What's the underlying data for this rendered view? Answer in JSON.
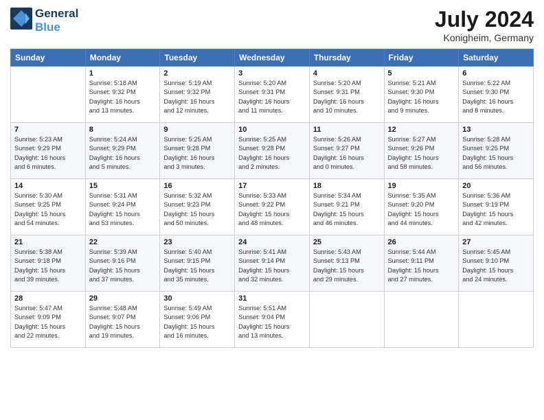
{
  "header": {
    "logo_line1": "General",
    "logo_line2": "Blue",
    "month": "July 2024",
    "location": "Konigheim, Germany"
  },
  "days_of_week": [
    "Sunday",
    "Monday",
    "Tuesday",
    "Wednesday",
    "Thursday",
    "Friday",
    "Saturday"
  ],
  "weeks": [
    [
      {
        "day": "",
        "info": ""
      },
      {
        "day": "1",
        "info": "Sunrise: 5:18 AM\nSunset: 9:32 PM\nDaylight: 16 hours\nand 13 minutes."
      },
      {
        "day": "2",
        "info": "Sunrise: 5:19 AM\nSunset: 9:32 PM\nDaylight: 16 hours\nand 12 minutes."
      },
      {
        "day": "3",
        "info": "Sunrise: 5:20 AM\nSunset: 9:31 PM\nDaylight: 16 hours\nand 11 minutes."
      },
      {
        "day": "4",
        "info": "Sunrise: 5:20 AM\nSunset: 9:31 PM\nDaylight: 16 hours\nand 10 minutes."
      },
      {
        "day": "5",
        "info": "Sunrise: 5:21 AM\nSunset: 9:30 PM\nDaylight: 16 hours\nand 9 minutes."
      },
      {
        "day": "6",
        "info": "Sunrise: 5:22 AM\nSunset: 9:30 PM\nDaylight: 16 hours\nand 8 minutes."
      }
    ],
    [
      {
        "day": "7",
        "info": "Sunrise: 5:23 AM\nSunset: 9:29 PM\nDaylight: 16 hours\nand 6 minutes."
      },
      {
        "day": "8",
        "info": "Sunrise: 5:24 AM\nSunset: 9:29 PM\nDaylight: 16 hours\nand 5 minutes."
      },
      {
        "day": "9",
        "info": "Sunrise: 5:25 AM\nSunset: 9:28 PM\nDaylight: 16 hours\nand 3 minutes."
      },
      {
        "day": "10",
        "info": "Sunrise: 5:25 AM\nSunset: 9:28 PM\nDaylight: 16 hours\nand 2 minutes."
      },
      {
        "day": "11",
        "info": "Sunrise: 5:26 AM\nSunset: 9:27 PM\nDaylight: 16 hours\nand 0 minutes."
      },
      {
        "day": "12",
        "info": "Sunrise: 5:27 AM\nSunset: 9:26 PM\nDaylight: 15 hours\nand 58 minutes."
      },
      {
        "day": "13",
        "info": "Sunrise: 5:28 AM\nSunset: 9:25 PM\nDaylight: 15 hours\nand 56 minutes."
      }
    ],
    [
      {
        "day": "14",
        "info": "Sunrise: 5:30 AM\nSunset: 9:25 PM\nDaylight: 15 hours\nand 54 minutes."
      },
      {
        "day": "15",
        "info": "Sunrise: 5:31 AM\nSunset: 9:24 PM\nDaylight: 15 hours\nand 53 minutes."
      },
      {
        "day": "16",
        "info": "Sunrise: 5:32 AM\nSunset: 9:23 PM\nDaylight: 15 hours\nand 50 minutes."
      },
      {
        "day": "17",
        "info": "Sunrise: 5:33 AM\nSunset: 9:22 PM\nDaylight: 15 hours\nand 48 minutes."
      },
      {
        "day": "18",
        "info": "Sunrise: 5:34 AM\nSunset: 9:21 PM\nDaylight: 15 hours\nand 46 minutes."
      },
      {
        "day": "19",
        "info": "Sunrise: 5:35 AM\nSunset: 9:20 PM\nDaylight: 15 hours\nand 44 minutes."
      },
      {
        "day": "20",
        "info": "Sunrise: 5:36 AM\nSunset: 9:19 PM\nDaylight: 15 hours\nand 42 minutes."
      }
    ],
    [
      {
        "day": "21",
        "info": "Sunrise: 5:38 AM\nSunset: 9:18 PM\nDaylight: 15 hours\nand 39 minutes."
      },
      {
        "day": "22",
        "info": "Sunrise: 5:39 AM\nSunset: 9:16 PM\nDaylight: 15 hours\nand 37 minutes."
      },
      {
        "day": "23",
        "info": "Sunrise: 5:40 AM\nSunset: 9:15 PM\nDaylight: 15 hours\nand 35 minutes."
      },
      {
        "day": "24",
        "info": "Sunrise: 5:41 AM\nSunset: 9:14 PM\nDaylight: 15 hours\nand 32 minutes."
      },
      {
        "day": "25",
        "info": "Sunrise: 5:43 AM\nSunset: 9:13 PM\nDaylight: 15 hours\nand 29 minutes."
      },
      {
        "day": "26",
        "info": "Sunrise: 5:44 AM\nSunset: 9:11 PM\nDaylight: 15 hours\nand 27 minutes."
      },
      {
        "day": "27",
        "info": "Sunrise: 5:45 AM\nSunset: 9:10 PM\nDaylight: 15 hours\nand 24 minutes."
      }
    ],
    [
      {
        "day": "28",
        "info": "Sunrise: 5:47 AM\nSunset: 9:09 PM\nDaylight: 15 hours\nand 22 minutes."
      },
      {
        "day": "29",
        "info": "Sunrise: 5:48 AM\nSunset: 9:07 PM\nDaylight: 15 hours\nand 19 minutes."
      },
      {
        "day": "30",
        "info": "Sunrise: 5:49 AM\nSunset: 9:06 PM\nDaylight: 15 hours\nand 16 minutes."
      },
      {
        "day": "31",
        "info": "Sunrise: 5:51 AM\nSunset: 9:04 PM\nDaylight: 15 hours\nand 13 minutes."
      },
      {
        "day": "",
        "info": ""
      },
      {
        "day": "",
        "info": ""
      },
      {
        "day": "",
        "info": ""
      }
    ]
  ]
}
